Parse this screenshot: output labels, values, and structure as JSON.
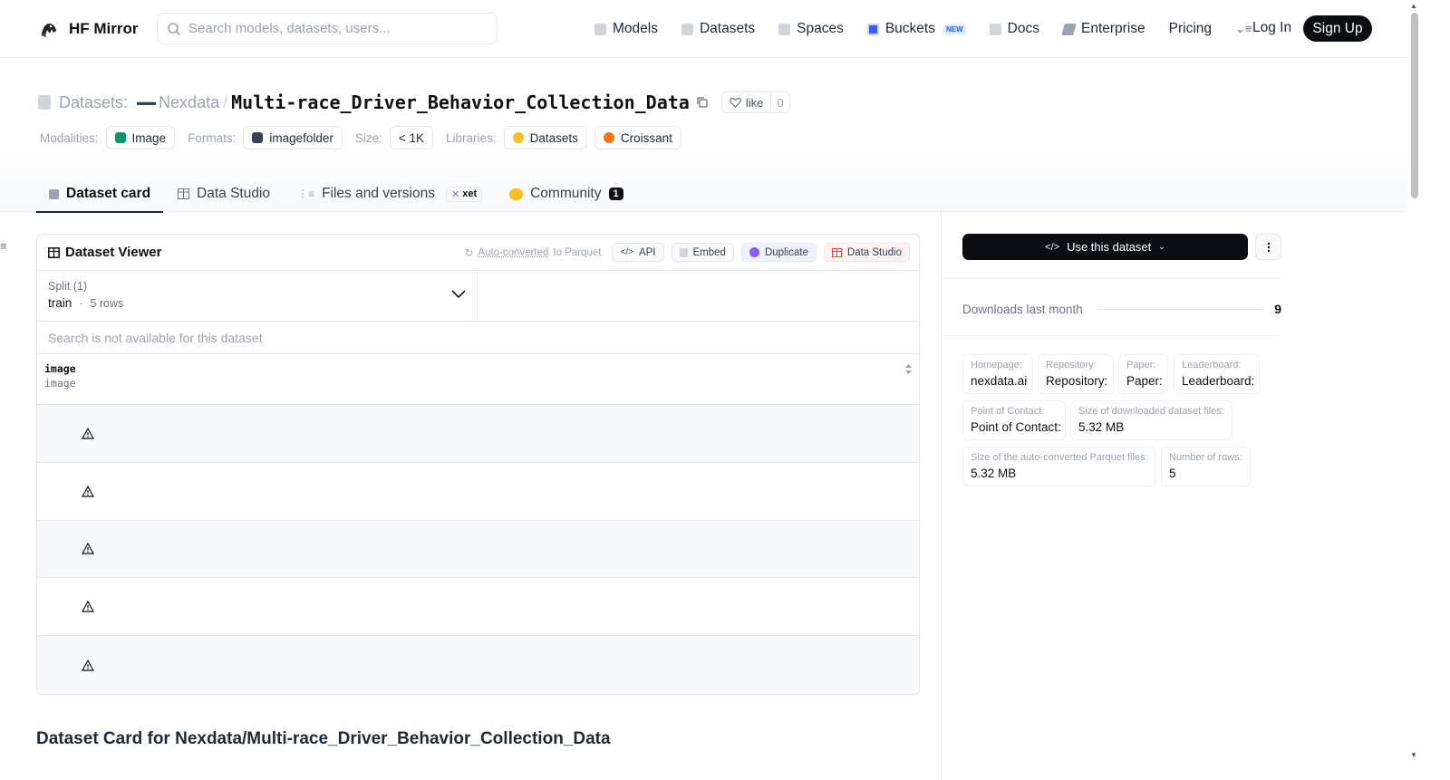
{
  "header": {
    "brand": "HF Mirror",
    "search_placeholder": "Search models, datasets, users...",
    "nav": [
      {
        "label": "Models",
        "icon": "cube-icon"
      },
      {
        "label": "Datasets",
        "icon": "database-icon"
      },
      {
        "label": "Spaces",
        "icon": "grid-icon"
      },
      {
        "label": "Buckets",
        "icon": "bucket-icon",
        "badge": "NEW"
      },
      {
        "label": "Docs",
        "icon": "book-icon"
      },
      {
        "label": "Enterprise",
        "icon": "enterprise-icon"
      },
      {
        "label": "Pricing"
      }
    ],
    "login": "Log In",
    "signup": "Sign Up"
  },
  "repo": {
    "type_label": "Datasets:",
    "org": "Nexdata",
    "separator": "/",
    "name": "Multi-race_Driver_Behavior_Collection_Data",
    "like_label": "like",
    "like_count": "0"
  },
  "tags": {
    "modalities_label": "Modalities:",
    "modality": "Image",
    "formats_label": "Formats:",
    "format": "imagefolder",
    "size_label": "Size:",
    "size": "< 1K",
    "libraries_label": "Libraries:",
    "libraries": [
      "Datasets",
      "Croissant"
    ]
  },
  "tabs": [
    {
      "label": "Dataset card",
      "active": true
    },
    {
      "label": "Data Studio"
    },
    {
      "label": "Files and versions",
      "badge": "xet"
    },
    {
      "label": "Community",
      "count": "1"
    }
  ],
  "viewer": {
    "title": "Dataset Viewer",
    "auto_prefix": "Auto-converted",
    "auto_suffix": " to Parquet",
    "api": "API",
    "embed": "Embed",
    "duplicate": "Duplicate",
    "studio": "Data Studio",
    "split_label": "Split (1)",
    "split_value": "train",
    "split_rows": "5 rows",
    "search_msg": "Search is not available for this dataset",
    "column_name": "image",
    "column_type": "image",
    "rows": [
      "broken-image",
      "broken-image",
      "broken-image",
      "broken-image",
      "broken-image"
    ]
  },
  "card_heading": "Dataset Card for Nexdata/Multi-race_Driver_Behavior_Collection_Data",
  "sidebar": {
    "use_button": "Use this dataset",
    "downloads_label": "Downloads last month",
    "downloads_value": "9",
    "meta": [
      {
        "label": "Homepage:",
        "value": "nexdata.ai"
      },
      {
        "label": "Repository:",
        "value": "Repository:"
      },
      {
        "label": "Paper:",
        "value": "Paper:"
      },
      {
        "label": "Leaderboard:",
        "value": "Leaderboard:"
      },
      {
        "label": "Point of Contact:",
        "value": "Point of Contact:"
      },
      {
        "label": "Size of downloaded dataset files:",
        "value": "5.32 MB"
      },
      {
        "label": "Size of the auto-converted Parquet files:",
        "value": "5.32 MB"
      },
      {
        "label": "Number of rows:",
        "value": "5"
      }
    ]
  },
  "colors": {
    "primary_dark": "#0b0d12",
    "muted_text": "#9ca3af",
    "border": "#e5e7eb"
  }
}
